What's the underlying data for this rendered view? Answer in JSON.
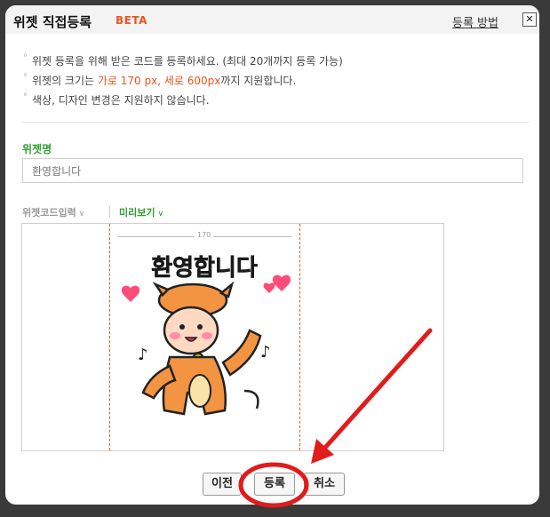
{
  "dialog": {
    "title": "위젯 직접등록",
    "badge": "BETA",
    "help_link": "등록 방법",
    "close_label": "✕"
  },
  "notes": {
    "line1": "위젯 등록을 위해 받은 코드를 등록하세요. (최대 20개까지 등록 가능)",
    "line2_before": "위젯의 크기는 ",
    "line2_highlight": "가로 170 px, 세로 600px",
    "line2_after": "까지 지원합니다.",
    "line3": "색상, 디자인 변경은 지원하지 않습니다."
  },
  "widget_name": {
    "label": "위젯명",
    "value": "환영합니다"
  },
  "tabs": {
    "code": "위젯코드입력",
    "preview": "미리보기",
    "active": "preview"
  },
  "preview": {
    "width_label": "170",
    "sticker_text": "환영합니다"
  },
  "buttons": {
    "prev": "이전",
    "register": "등록",
    "cancel": "취소"
  },
  "colors": {
    "accent_green": "#2f9e2f",
    "accent_orange": "#e8541d",
    "annotation_red": "#e21b1b"
  },
  "icons": {
    "close": "close-icon",
    "dropdown": "chevron-down-icon",
    "note_bullet": "bullet-icon"
  }
}
